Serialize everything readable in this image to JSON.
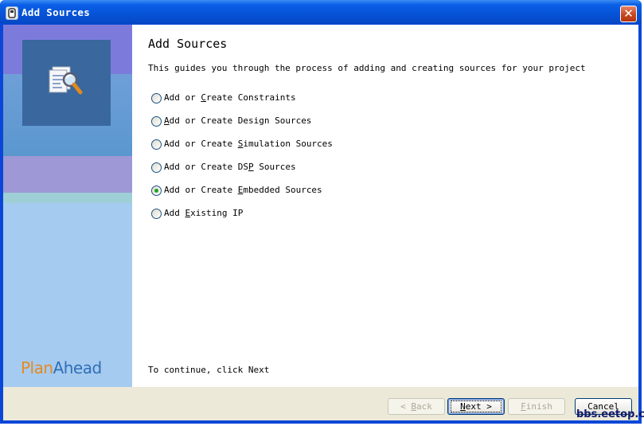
{
  "window": {
    "title": "Add Sources",
    "close_label": "✕"
  },
  "sidebar": {
    "brand_part1": "Plan",
    "brand_part2": "Ahead"
  },
  "main": {
    "heading": "Add Sources",
    "description": "This guides you through the process of adding and creating sources for your project",
    "options": [
      {
        "pre": "Add or ",
        "mnemonic": "C",
        "post": "reate Constraints",
        "selected": false
      },
      {
        "pre": "",
        "mnemonic": "A",
        "post": "dd or Create Design Sources",
        "selected": false
      },
      {
        "pre": "Add or Create ",
        "mnemonic": "S",
        "post": "imulation Sources",
        "selected": false
      },
      {
        "pre": "Add or Create DS",
        "mnemonic": "P",
        "post": " Sources",
        "selected": false
      },
      {
        "pre": "Add or Create ",
        "mnemonic": "E",
        "post": "mbedded Sources",
        "selected": true
      },
      {
        "pre": "Add ",
        "mnemonic": "E",
        "post": "xisting IP",
        "selected": false
      }
    ],
    "continue_text": "To continue, click Next"
  },
  "footer": {
    "back": {
      "pre": "< ",
      "mnemonic": "B",
      "post": "ack",
      "enabled": false
    },
    "next": {
      "pre": "",
      "mnemonic": "N",
      "post": "ext >",
      "enabled": true,
      "default": true
    },
    "finish": {
      "pre": "",
      "mnemonic": "F",
      "post": "inish",
      "enabled": false
    },
    "cancel": {
      "label": "Cancel",
      "enabled": true
    }
  },
  "watermark": "bbs.eetop.cn"
}
